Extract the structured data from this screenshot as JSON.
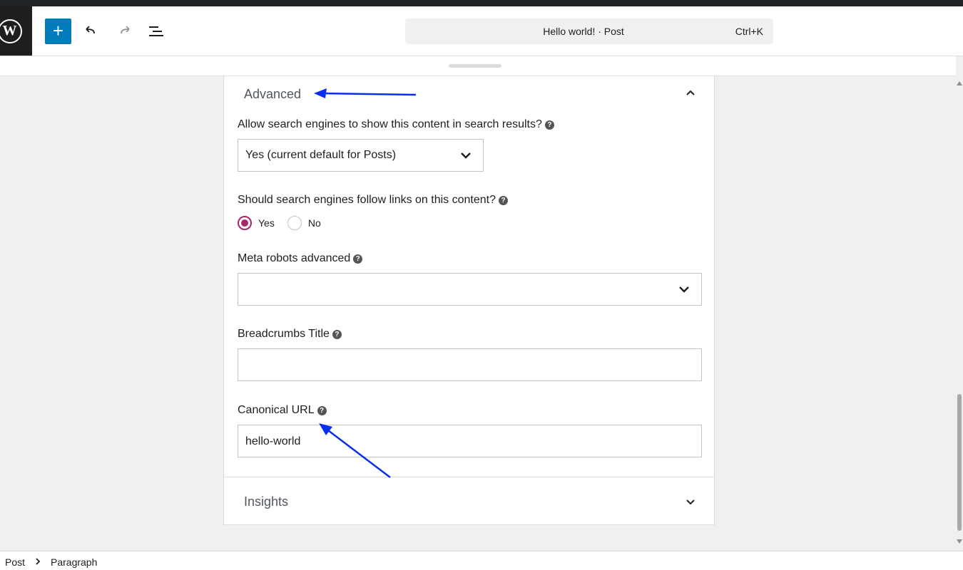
{
  "header": {
    "doc_title": "Hello world! · Post",
    "shortcut": "Ctrl+K",
    "add_label": "+"
  },
  "panel": {
    "advanced_title": "Advanced",
    "insights_title": "Insights",
    "fields": {
      "search_visibility": {
        "label": "Allow search engines to show this content in search results?",
        "value": "Yes (current default for Posts)"
      },
      "follow_links": {
        "label": "Should search engines follow links on this content?",
        "options": [
          "Yes",
          "No"
        ],
        "selected": "Yes"
      },
      "meta_robots": {
        "label": "Meta robots advanced",
        "value": ""
      },
      "breadcrumbs_title": {
        "label": "Breadcrumbs Title",
        "value": ""
      },
      "canonical_url": {
        "label": "Canonical URL",
        "value": "hello-world"
      }
    }
  },
  "footer": {
    "breadcrumbs": [
      "Post",
      "Paragraph"
    ]
  },
  "colors": {
    "accent": "#007cba",
    "radio_checked": "#a4286a",
    "annotation_arrow": "#0a2ef0"
  },
  "icons": {
    "logo": "wordpress-logo",
    "help": "question-mark-icon"
  }
}
